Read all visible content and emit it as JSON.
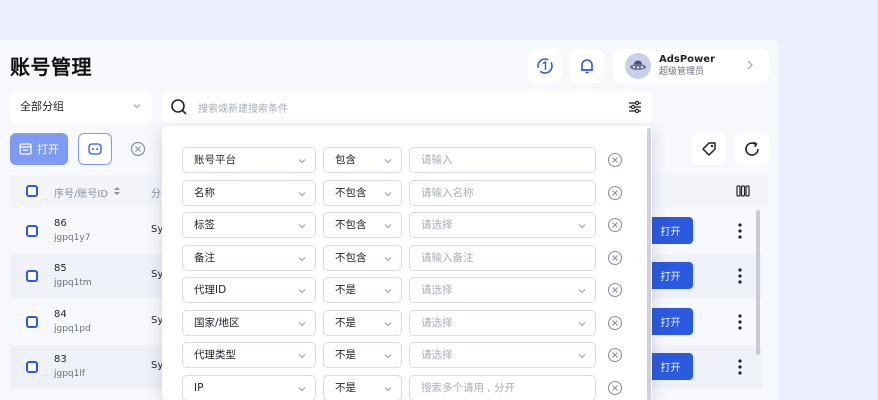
{
  "page": {
    "title": "账号管理"
  },
  "user": {
    "name": "AdsPower",
    "role": "超级管理员"
  },
  "toolbar": {
    "group_label": "全部分组",
    "search_placeholder": "搜索或新建搜索条件",
    "open_label": "打开"
  },
  "table": {
    "header_index": "序号/账号ID",
    "header_truncated": "分",
    "rows": [
      {
        "num": "86",
        "account": "jgpq1y7",
        "platform": "Sy",
        "action": "打开"
      },
      {
        "num": "85",
        "account": "jgpq1tm",
        "platform": "Sy",
        "action": "打开"
      },
      {
        "num": "84",
        "account": "jgpq1pd",
        "platform": "Sy",
        "action": "打开"
      },
      {
        "num": "83",
        "account": "jgpq1lf",
        "platform": "Sy",
        "action": "打开"
      }
    ]
  },
  "filters": [
    {
      "field": "账号平台",
      "op": "包含",
      "value": "请输入",
      "value_has_chevron": false
    },
    {
      "field": "名称",
      "op": "不包含",
      "value": "请输入名称",
      "value_has_chevron": false
    },
    {
      "field": "标签",
      "op": "不包含",
      "value": "请选择",
      "value_has_chevron": true
    },
    {
      "field": "备注",
      "op": "不包含",
      "value": "请输入备注",
      "value_has_chevron": false
    },
    {
      "field": "代理ID",
      "op": "不是",
      "value": "请选择",
      "value_has_chevron": true
    },
    {
      "field": "国家/地区",
      "op": "不是",
      "value": "请选择",
      "value_has_chevron": true
    },
    {
      "field": "代理类型",
      "op": "不是",
      "value": "请选择",
      "value_has_chevron": true
    },
    {
      "field": "IP",
      "op": "不是",
      "value": "搜索多个请用 , 分开",
      "value_has_chevron": false
    }
  ],
  "colors": {
    "primary": "#2b5ae0",
    "primary_light": "#7d9bf5",
    "background": "#eceffe"
  }
}
